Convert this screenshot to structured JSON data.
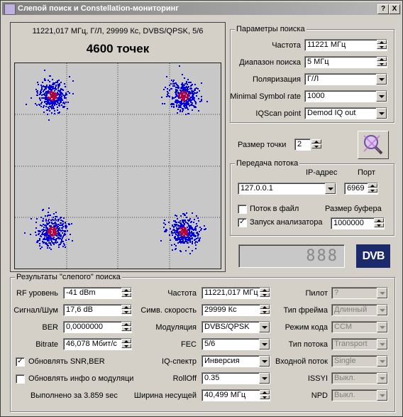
{
  "window": {
    "title": "Слепой поиск и Constellation-мониторинг",
    "help_label": "?",
    "close_label": "X"
  },
  "plot": {
    "info": "11221,017 МГц, Г/Л, 29999 Кс, DVBS/QPSK, 5/6",
    "points_label": "4600 точек"
  },
  "search_params": {
    "group_label": "Параметры поиска",
    "frequency": {
      "label": "Частота",
      "value": "11221 МГц"
    },
    "range": {
      "label": "Диапазон поиска",
      "value": "5 МГц"
    },
    "polarization": {
      "label": "Поляризация",
      "value": "Г/Л"
    },
    "min_sr": {
      "label": "Minimal Symbol rate",
      "value": "1000"
    },
    "iqscan": {
      "label": "IQScan point",
      "value": "Demod IQ out"
    }
  },
  "point_size": {
    "label": "Размер точки",
    "value": "2"
  },
  "stream": {
    "group_label": "Передача потока",
    "ip_label": "IP-адрес",
    "port_label": "Порт",
    "ip_value": "127.0.0.1",
    "port_value": "6969",
    "to_file_label": "Поток в файл",
    "buffer_label": "Размер буфера",
    "run_analyzer_label": "Запуск анализатора",
    "buffer_value": "1000000"
  },
  "led_display": "888",
  "dvb_logo": "DVB",
  "results": {
    "group_label": "Результаты \"слепого\" поиска",
    "rf_level": {
      "label": "RF уровень",
      "value": "-41 dBm"
    },
    "snr": {
      "label": "Сигнал/Шум",
      "value": "17,6 dB"
    },
    "ber": {
      "label": "BER",
      "value": "0,0000000"
    },
    "bitrate": {
      "label": "Bitrate",
      "value": "46,078 Мбит/с"
    },
    "update_snr_label": "Обновлять SNR,BER",
    "update_mod_label": "Обновлять инфо о модуляции",
    "done_label": "Выполнено за 3.859 sec",
    "frequency": {
      "label": "Частота",
      "value": "11221,017 МГц"
    },
    "symbol_rate": {
      "label": "Симв. скорость",
      "value": "29999 Кс"
    },
    "modulation": {
      "label": "Модуляция",
      "value": "DVBS/QPSK"
    },
    "fec": {
      "label": "FEC",
      "value": "5/6"
    },
    "iq_spectrum": {
      "label": "IQ-спектр",
      "value": "Инверсия"
    },
    "rolloff": {
      "label": "RollOff",
      "value": "0.35"
    },
    "bandwidth": {
      "label": "Ширина несущей",
      "value": "40,499 МГц"
    },
    "pilot": {
      "label": "Пилот",
      "value": "?"
    },
    "frame_type": {
      "label": "Тип фрейма",
      "value": "Длинный"
    },
    "code_mode": {
      "label": "Режим кода",
      "value": "CCM"
    },
    "stream_type": {
      "label": "Тип потока",
      "value": "Transport"
    },
    "input_stream": {
      "label": "Входной поток",
      "value": "Single"
    },
    "issyi": {
      "label": "ISSYI",
      "value": "Выкл."
    },
    "npd": {
      "label": "NPD",
      "value": "Выкл."
    }
  },
  "colors": {
    "constellation_outer": "#0000e0",
    "constellation_inner": "#b00040",
    "plot_background": "#c8c8c8"
  }
}
